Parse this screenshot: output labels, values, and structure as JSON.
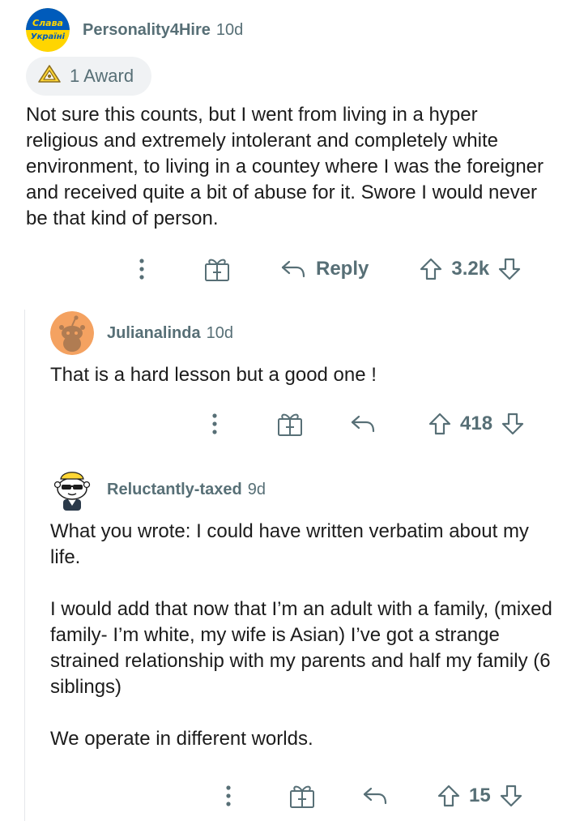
{
  "comments": [
    {
      "author": "Personality4Hire",
      "time": "10d",
      "avatar_text_top": "Слава",
      "avatar_text_bottom": "Україні",
      "award_label": "1 Award",
      "paragraphs": [
        "Not sure this counts, but I went from living in a hyper religious and extremely intolerant and completely white environment, to living in a countey where I was the foreigner and received quite a bit of abuse for it. Swore I would never be that kind of person."
      ],
      "reply_label": "Reply",
      "score": "3.2k"
    },
    {
      "author": "Julianalinda",
      "time": "10d",
      "paragraphs": [
        "That is a hard lesson but a good one !"
      ],
      "score": "418"
    },
    {
      "author": "Reluctantly-taxed",
      "time": "9d",
      "paragraphs": [
        "What you wrote: I could have written verbatim about my life.",
        "I would add that now that I’m an adult with a family, (mixed family- I’m white, my wife is Asian) I’ve got a strange strained relationship with my parents and half my family (6 siblings)",
        "We operate in different worlds."
      ],
      "score": "15"
    }
  ],
  "colors": {
    "meta_gray": "#576f76",
    "text": "#1c1c1c",
    "award_bg": "#f0f2f4",
    "ukraine_blue": "#005bbb",
    "ukraine_yellow": "#ffd500",
    "snoo_orange": "#f4a261"
  },
  "icons": [
    "more-options-icon",
    "give-award-icon",
    "reply-arrow-icon",
    "upvote-icon",
    "downvote-icon",
    "award-icon"
  ]
}
